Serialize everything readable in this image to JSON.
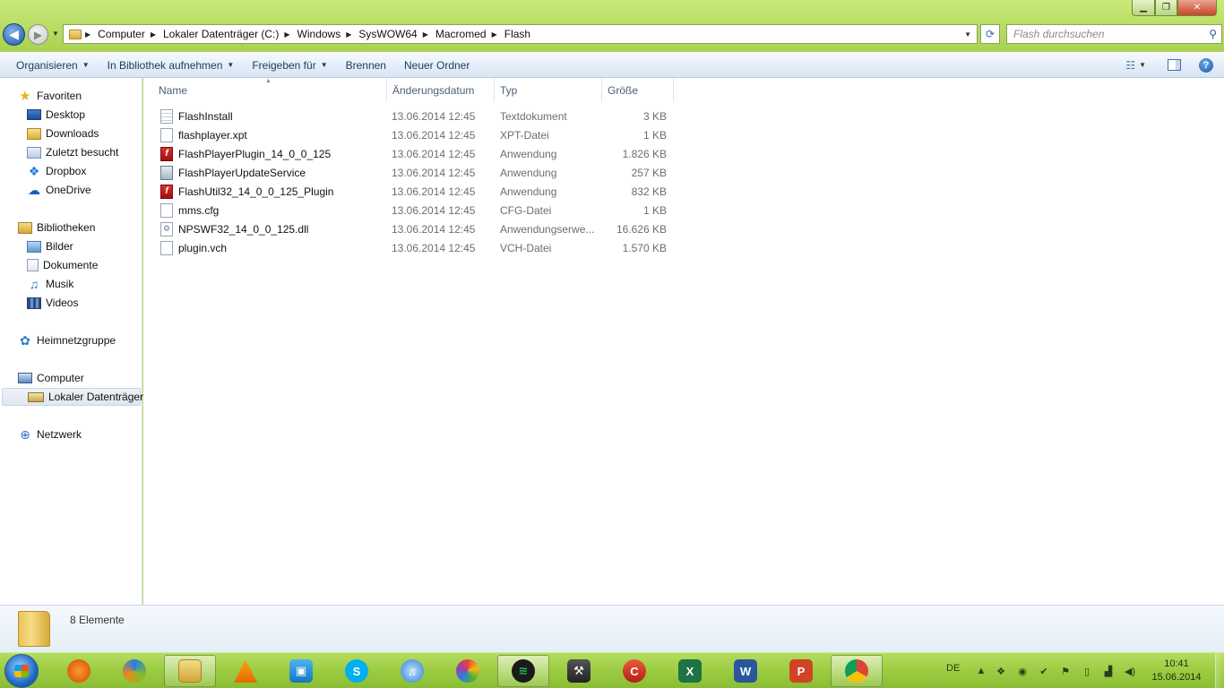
{
  "window": {
    "controls": {
      "minimize": "▁",
      "maximize": "❐",
      "close": "✕"
    }
  },
  "navigation": {
    "back_glyph": "◀",
    "forward_glyph": "▶",
    "breadcrumb": [
      "Computer",
      "Lokaler Datenträger (C:)",
      "Windows",
      "SysWOW64",
      "Macromed",
      "Flash"
    ],
    "search_placeholder": "Flash durchsuchen"
  },
  "toolbar": {
    "organize": "Organisieren",
    "include_library": "In Bibliothek aufnehmen",
    "share": "Freigeben für",
    "burn": "Brennen",
    "new_folder": "Neuer Ordner"
  },
  "sidebar": {
    "favorites": {
      "label": "Favoriten",
      "items": [
        "Desktop",
        "Downloads",
        "Zuletzt besucht",
        "Dropbox",
        "OneDrive"
      ]
    },
    "libraries": {
      "label": "Bibliotheken",
      "items": [
        "Bilder",
        "Dokumente",
        "Musik",
        "Videos"
      ]
    },
    "homegroup": "Heimnetzgruppe",
    "computer": {
      "label": "Computer",
      "items": [
        "Lokaler Datenträger"
      ]
    },
    "network": "Netzwerk"
  },
  "file_list": {
    "columns": {
      "name": "Name",
      "date": "Änderungsdatum",
      "type": "Typ",
      "size": "Größe"
    },
    "files": [
      {
        "name": "FlashInstall",
        "date": "13.06.2014 12:45",
        "type": "Textdokument",
        "size": "3 KB",
        "icon": "text-file-icon"
      },
      {
        "name": "flashplayer.xpt",
        "date": "13.06.2014 12:45",
        "type": "XPT-Datei",
        "size": "1 KB",
        "icon": "blank-file-icon"
      },
      {
        "name": "FlashPlayerPlugin_14_0_0_125",
        "date": "13.06.2014 12:45",
        "type": "Anwendung",
        "size": "1.826 KB",
        "icon": "flash-icon"
      },
      {
        "name": "FlashPlayerUpdateService",
        "date": "13.06.2014 12:45",
        "type": "Anwendung",
        "size": "257 KB",
        "icon": "application-icon"
      },
      {
        "name": "FlashUtil32_14_0_0_125_Plugin",
        "date": "13.06.2014 12:45",
        "type": "Anwendung",
        "size": "832 KB",
        "icon": "flash-icon"
      },
      {
        "name": "mms.cfg",
        "date": "13.06.2014 12:45",
        "type": "CFG-Datei",
        "size": "1 KB",
        "icon": "blank-file-icon"
      },
      {
        "name": "NPSWF32_14_0_0_125.dll",
        "date": "13.06.2014 12:45",
        "type": "Anwendungserwe...",
        "size": "16.626 KB",
        "icon": "dll-file-icon"
      },
      {
        "name": "plugin.vch",
        "date": "13.06.2014 12:45",
        "type": "VCH-Datei",
        "size": "1.570 KB",
        "icon": "blank-file-icon"
      }
    ]
  },
  "details": {
    "item_count": "8 Elemente"
  },
  "taskbar": {
    "apps": [
      {
        "name": "firefox",
        "color": "#e66000"
      },
      {
        "name": "ccleaner-like",
        "color": "#5a5a5a"
      },
      {
        "name": "explorer",
        "color": "#e3b94a",
        "active": true
      },
      {
        "name": "vlc",
        "color": "#f08a00"
      },
      {
        "name": "photo-viewer",
        "color": "#1f8fd1"
      },
      {
        "name": "skype",
        "color": "#00aff0"
      },
      {
        "name": "itunes",
        "color": "#2b7fd6"
      },
      {
        "name": "picasa",
        "color": "#d94a8c"
      },
      {
        "name": "spotify",
        "color": "#1db954",
        "active": true
      },
      {
        "name": "tool",
        "color": "#3a3a3a"
      },
      {
        "name": "ccleaner",
        "color": "#d2352a"
      },
      {
        "name": "excel",
        "color": "#1f7244"
      },
      {
        "name": "word",
        "color": "#2b579a"
      },
      {
        "name": "powerpoint",
        "color": "#d04423"
      },
      {
        "name": "chrome",
        "color": "#dd4b39",
        "active": true
      }
    ],
    "language": "DE",
    "time": "10:41",
    "date": "15.06.2014"
  }
}
